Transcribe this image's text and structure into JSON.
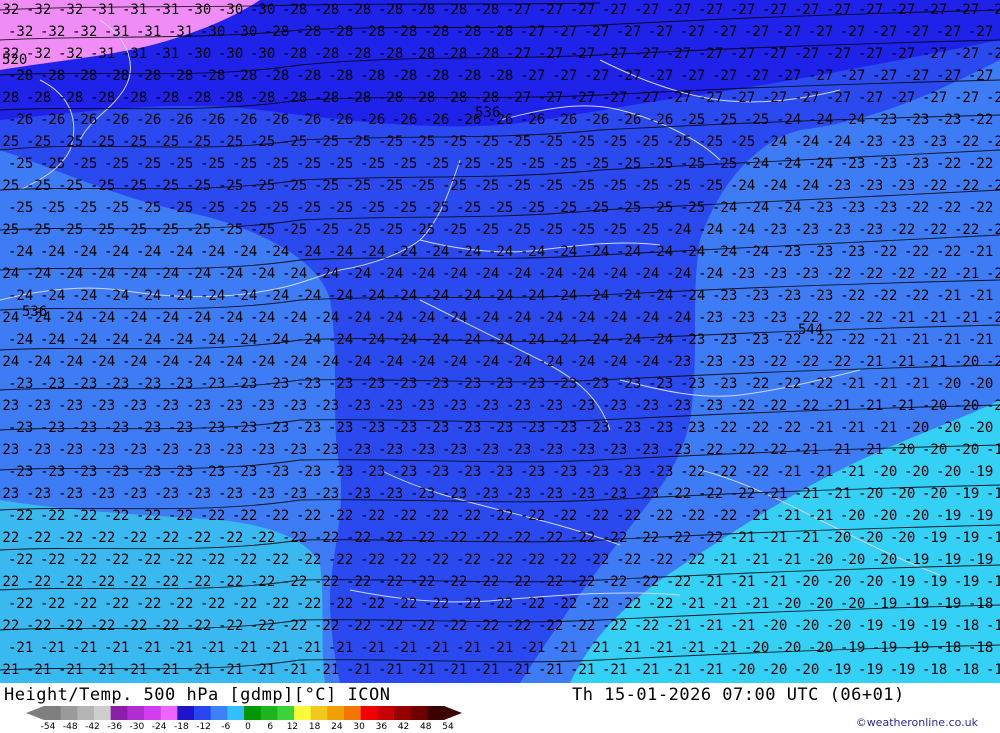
{
  "map": {
    "kind": "weather contour map",
    "colors": {
      "magenta": "#f08cf5",
      "blue_dark": "#1f22e8",
      "blue_mid": "#2a4af0",
      "blue_light": "#3d7cf5",
      "cyan_light": "#3ab8f0",
      "cyan": "#35d0f5",
      "coast": "#cfd6ff"
    },
    "contour_labels": [
      "-32",
      "-31",
      "-30",
      "-29",
      "-28",
      "-27",
      "-26",
      "-25",
      "-24",
      "-23",
      "-22",
      "-21",
      "-20",
      "-19",
      "-18"
    ],
    "height_labels": [
      "536",
      "544",
      "520",
      "536"
    ]
  },
  "footer": {
    "title_left": "Height/Temp. 500 hPa [gdmp][°C] ICON",
    "title_right": "Th 15-01-2026 07:00 UTC (06+01)",
    "credit": "©weatheronline.co.uk",
    "legend": {
      "labels": [
        "-54",
        "-48",
        "-42",
        "-36",
        "-30",
        "-24",
        "-18",
        "-12",
        "-6",
        "0",
        "6",
        "12",
        "18",
        "24",
        "30",
        "36",
        "42",
        "48",
        "54"
      ],
      "colors": [
        "#7f7f7f",
        "#9a9a9a",
        "#b4b4b4",
        "#cdcdcd",
        "#8c1fa8",
        "#b02ed0",
        "#d23cf0",
        "#ee64ff",
        "#1e14c8",
        "#2846f0",
        "#3c82f5",
        "#32beff",
        "#009600",
        "#1eb41e",
        "#3cd23c",
        "#fafa3c",
        "#f0c81e",
        "#f0a000",
        "#f07800",
        "#f00000",
        "#c80000",
        "#960000",
        "#6e0000",
        "#3c0000"
      ]
    }
  }
}
